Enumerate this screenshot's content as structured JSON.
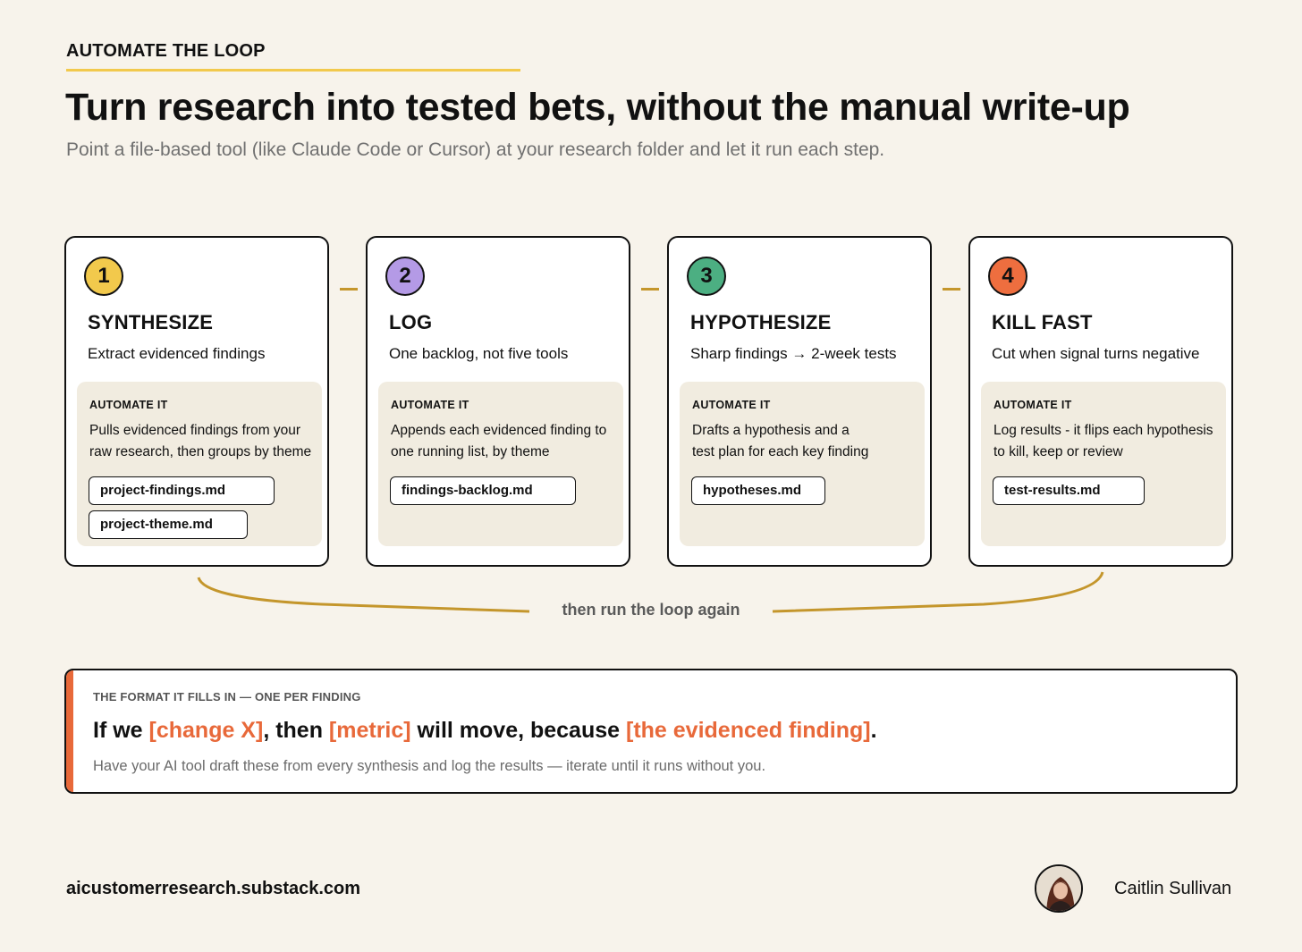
{
  "header": {
    "eyebrow": "AUTOMATE THE LOOP",
    "title": "Turn research into tested bets, without the manual write-up",
    "subtitle": "Point a file-based tool (like Claude Code or Cursor) at your research folder and let it run each step."
  },
  "steps": [
    {
      "number": "1",
      "title": "SYNTHESIZE",
      "subtitle": "Extract evidenced findings",
      "automate_label": "AUTOMATE IT",
      "automate_desc": "Pulls evidenced findings from your raw research, then groups by theme",
      "files": [
        "project-findings.md",
        "project-theme.md"
      ],
      "color": "#f2c94c"
    },
    {
      "number": "2",
      "title": "LOG",
      "subtitle": "One backlog, not five tools",
      "automate_label": "AUTOMATE IT",
      "automate_desc": "Appends each evidenced finding to one running list, by theme",
      "files": [
        "findings-backlog.md"
      ],
      "color": "#b49ae6"
    },
    {
      "number": "3",
      "title": "HYPOTHESIZE",
      "subtitle": "Sharp findings → 2-week tests",
      "automate_label": "AUTOMATE IT",
      "automate_desc": "Drafts a hypothesis and a test plan for each key finding",
      "files": [
        "hypotheses.md"
      ],
      "color": "#4caf82"
    },
    {
      "number": "4",
      "title": "KILL FAST",
      "subtitle": "Cut when signal turns negative",
      "automate_label": "AUTOMATE IT",
      "automate_desc": "Log results - it flips each hypothesis to kill, keep or review",
      "files": [
        "test-results.md"
      ],
      "color": "#ee6e3f"
    }
  ],
  "loop": {
    "label": "then run the loop again"
  },
  "format": {
    "label": "THE FORMAT IT FILLS IN — ONE PER FINDING",
    "sentence": {
      "p1": "If we ",
      "h1": "[change X]",
      "p2": ", then ",
      "h2": "[metric]",
      "p3": " will move, because ",
      "h3": "[the evidenced finding]",
      "p4": "."
    },
    "note": "Have your AI tool draft these from every synthesis and log the results — iterate until it runs without you."
  },
  "footer": {
    "url": "aicustomerresearch.substack.com",
    "author": "Caitlin Sullivan"
  },
  "colors": {
    "accent": "#e8693a",
    "connector": "#c4962c",
    "eyebrow_rule": "#f2c94c",
    "background": "#f7f3eb"
  }
}
